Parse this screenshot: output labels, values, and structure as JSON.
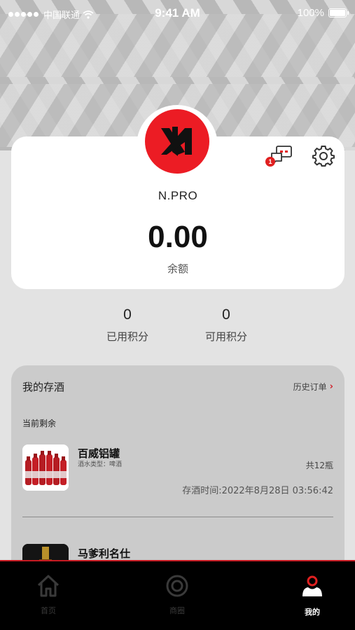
{
  "status_bar": {
    "carrier": "中国联通",
    "time": "9:41 AM",
    "battery": "100%"
  },
  "profile": {
    "message_badge": "1",
    "username": "N.PRO",
    "balance": "0.00",
    "balance_label": "余额"
  },
  "points": {
    "used_value": "0",
    "used_label": "已用积分",
    "available_value": "0",
    "available_label": "可用积分"
  },
  "cellar": {
    "title": "我的存酒",
    "history_link": "历史订单",
    "remaining_label": "当前剩余",
    "items": [
      {
        "name": "百威铝罐",
        "type": "酒水类型：啤酒",
        "quantity": "共12瓶",
        "stored_time": "存酒时间:2022年8月28日 03:56:42"
      },
      {
        "name": "马爹利名仕"
      }
    ]
  },
  "tabbar": {
    "tabs": [
      {
        "label": "首页",
        "icon": "home-icon"
      },
      {
        "label": "商圈",
        "icon": "circle-icon"
      },
      {
        "label": "我的",
        "icon": "user-icon"
      }
    ],
    "active_index": 2
  },
  "colors": {
    "accent": "#ec1c24",
    "tabbar_bg": "#000000",
    "card_bg": "#ffffff",
    "cellar_bg": "#cbcbcb"
  }
}
